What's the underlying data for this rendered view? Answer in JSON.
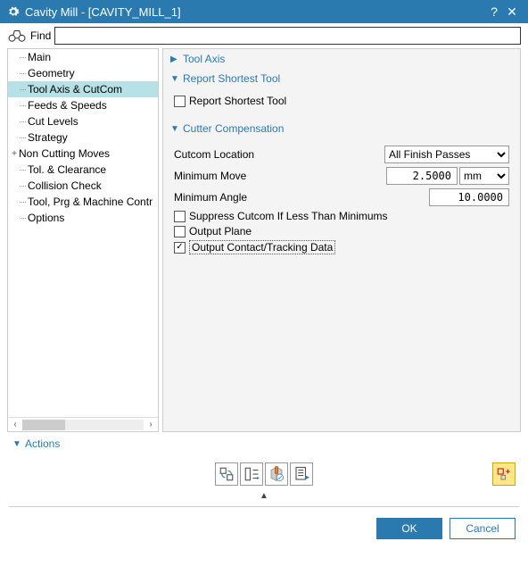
{
  "title": "Cavity Mill - [CAVITY_MILL_1]",
  "find_label": "Find",
  "tree": [
    {
      "label": "Main",
      "depth": 1
    },
    {
      "label": "Geometry",
      "depth": 1
    },
    {
      "label": "Tool Axis & CutCom",
      "depth": 1,
      "selected": true
    },
    {
      "label": "Feeds & Speeds",
      "depth": 1
    },
    {
      "label": "Cut Levels",
      "depth": 1
    },
    {
      "label": "Strategy",
      "depth": 1
    },
    {
      "label": "Non Cutting Moves",
      "depth": 0,
      "exp": "+"
    },
    {
      "label": "Tol. & Clearance",
      "depth": 1
    },
    {
      "label": "Collision Check",
      "depth": 1
    },
    {
      "label": "Tool, Prg & Machine Contr",
      "depth": 1
    },
    {
      "label": "Options",
      "depth": 1
    }
  ],
  "s1": {
    "title": "Tool Axis"
  },
  "s2": {
    "title": "Report Shortest Tool",
    "c1": "Report Shortest Tool"
  },
  "s3": {
    "title": "Cutter Compensation",
    "loc_lbl": "Cutcom Location",
    "loc_val": "All Finish Passes",
    "mm_lbl": "Minimum Move",
    "mm_val": "2.5000",
    "mm_unit": "mm",
    "ma_lbl": "Minimum Angle",
    "ma_val": "10.0000",
    "c1": "Suppress Cutcom If Less Than Minimums",
    "c2": "Output Plane",
    "c3": "Output Contact/Tracking Data"
  },
  "actions": "Actions",
  "ok": "OK",
  "cancel": "Cancel"
}
